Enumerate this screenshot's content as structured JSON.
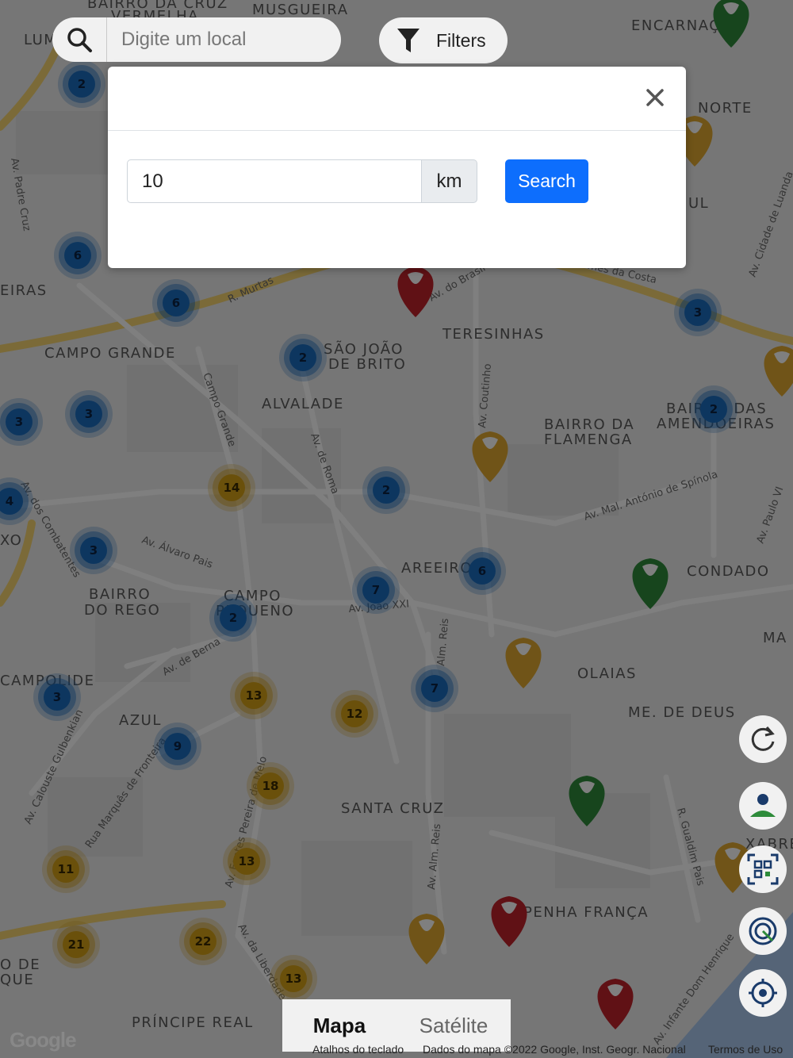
{
  "search": {
    "placeholder": "Digite um local"
  },
  "filters": {
    "label": "Filters"
  },
  "modal": {
    "distance_value": "10",
    "distance_unit": "km",
    "search_label": "Search"
  },
  "map_labels": [
    "BAIRRO DA CRUZ VERMELHA",
    "MUSGUEIRA",
    "ENCARNAÇÃO",
    "NORTE",
    "UL",
    "EIRAS",
    "CAMPO GRANDE",
    "SÃO JOÃO",
    "DE BRITO",
    "TERESINHAS",
    "ALVALADE",
    "BAIRRO DA",
    "FLAMENGA",
    "BAIRRO DAS",
    "AMENDOEIRAS",
    "AREEIRO",
    "CONDADO",
    "BAIRRO",
    "DO REGO",
    "CAMPO",
    "PEQUENO",
    "MA",
    "OLAIAS",
    "CAMPOLIDE",
    "AZUL",
    "ME. DE DEUS",
    "SANTA CRUZ",
    "XABREGA",
    "PENHA FRANÇA",
    "O DE",
    "QUE",
    "PRÍNCIPE REAL",
    "LUM",
    "XO"
  ],
  "street_labels": [
    "Av. Padre Cruz",
    "R. Murtas",
    "Av. do Brasil",
    "Av. Gomes da Costa",
    "Av. Cidade de Luanda",
    "Campo Grande",
    "Av. de Roma",
    "Av. Coutinho",
    "Av. Mal. António de Spínola",
    "Av. dos Combatentes",
    "Av. Álvaro Pais",
    "Av. João XXI",
    "Alm. Reis",
    "Av. de Berna",
    "Av. Calouste Gulbenkian",
    "Rua Marquês de Fronteira",
    "Av. Fontes Pereira de Melo",
    "Av. Alm. Reis",
    "R. Gualdim Pais",
    "Av. da Liberdade",
    "Av. Infante Dom Henrique",
    "Av. Paulo VI"
  ],
  "clusters_blue": [
    "2",
    "6",
    "6",
    "2",
    "3",
    "3",
    "4",
    "3",
    "2",
    "7",
    "6",
    "2",
    "3",
    "7",
    "3",
    "9",
    "2",
    "3"
  ],
  "clusters_yellow": [
    "14",
    "13",
    "12",
    "18",
    "13",
    "11",
    "21",
    "22",
    "13"
  ],
  "map_type": {
    "map": "Mapa",
    "satellite": "Satélite"
  },
  "footer": {
    "shortcuts": "Atalhos do teclado",
    "data": "Dados do mapa ©2022 Google, Inst. Geogr. Nacional",
    "terms": "Termos de Uso"
  },
  "logo": "Google",
  "colors": {
    "blue_cluster": "#1a6dbf",
    "yellow_cluster": "#d4a017",
    "pin_red": "#c0232b",
    "pin_yellow": "#e0a830",
    "pin_green": "#2e8b3a",
    "primary_button": "#0d6efd"
  }
}
